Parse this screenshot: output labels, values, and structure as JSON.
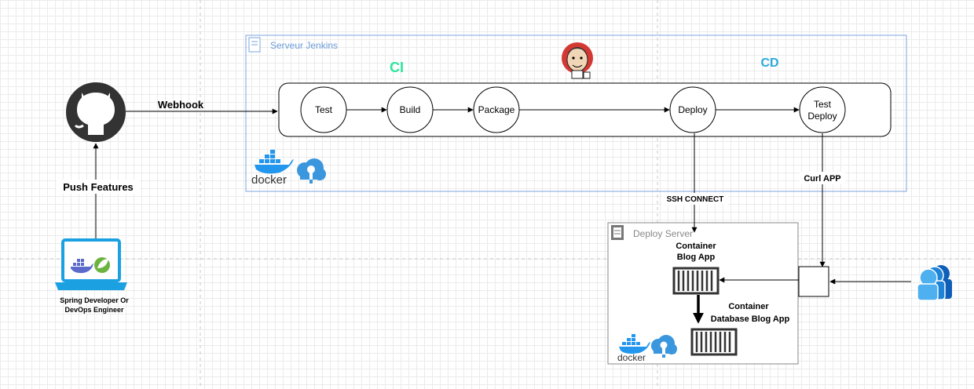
{
  "colors": {
    "jenkins_border": "#7ea6e0",
    "jenkins_text": "#6b9bd8",
    "ci": "#2ee59d",
    "cd": "#29a9e1",
    "deploy_border": "#888888",
    "docker_blue": "#2396ed",
    "azure_blue": "#3a96dd",
    "jenkins_red": "#d33833"
  },
  "jenkins_server": {
    "label": "Serveur Jenkins"
  },
  "ci_label": "CI",
  "cd_label": "CD",
  "stages": {
    "test": "Test",
    "build": "Build",
    "package": "Package",
    "deploy": "Deploy",
    "test_deploy_line1": "Test",
    "test_deploy_line2": "Deploy"
  },
  "edges": {
    "webhook": "Webhook",
    "push_features": "Push Features",
    "ssh_connect": "SSH CONNECT",
    "curl_app": "Curl APP"
  },
  "developer": {
    "line1": "Spring Developer Or",
    "line2": "DevOps Engineer"
  },
  "deploy_server": {
    "label": "Deploy Server"
  },
  "containers": {
    "blog_line1": "Container",
    "blog_line2": "Blog App",
    "db_line1": "Container",
    "db_line2": "Database Blog App"
  },
  "docker_wordmark": "docker",
  "icons": [
    "github-icon",
    "laptop-icon",
    "docker-icon",
    "spring-icon",
    "jenkins-icon",
    "server-icon",
    "azure-key-icon",
    "container-icon",
    "users-icon"
  ]
}
